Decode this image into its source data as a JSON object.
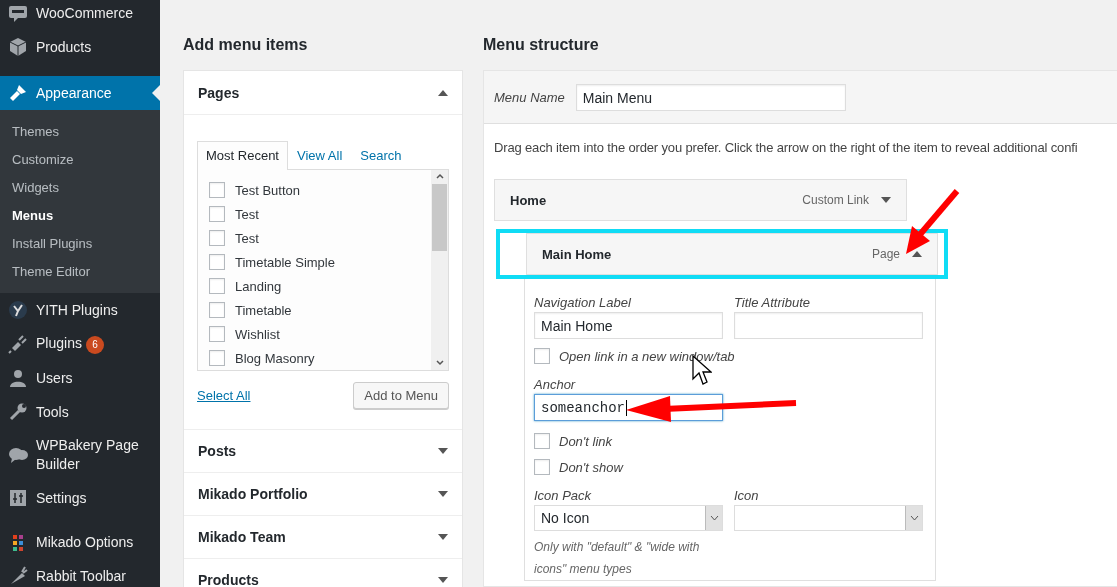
{
  "sidebar": {
    "items": [
      {
        "label": "WooCommerce",
        "selected": false
      },
      {
        "label": "Products",
        "selected": false
      },
      {
        "label": "Appearance",
        "selected": true,
        "children": [
          {
            "label": "Themes",
            "selected": false
          },
          {
            "label": "Customize",
            "selected": false
          },
          {
            "label": "Widgets",
            "selected": false
          },
          {
            "label": "Menus",
            "selected": true
          },
          {
            "label": "Install Plugins",
            "selected": false
          },
          {
            "label": "Theme Editor",
            "selected": false
          }
        ]
      },
      {
        "label": "YITH Plugins",
        "selected": false
      },
      {
        "label": "Plugins",
        "selected": false,
        "badge": "6"
      },
      {
        "label": "Users",
        "selected": false
      },
      {
        "label": "Tools",
        "selected": false
      },
      {
        "label": "WPBakery Page Builder",
        "selected": false
      },
      {
        "label": "Settings",
        "selected": false
      },
      {
        "label": "Mikado Options",
        "selected": false
      },
      {
        "label": "Rabbit Toolbar",
        "selected": false
      }
    ]
  },
  "add_menu_items": {
    "title": "Add menu items",
    "sections": [
      {
        "title": "Pages",
        "expanded": true,
        "tabs": [
          {
            "label": "Most Recent",
            "selected": true
          },
          {
            "label": "View All",
            "selected": false
          },
          {
            "label": "Search",
            "selected": false
          }
        ],
        "items": [
          {
            "label": "Test Button",
            "checked": false
          },
          {
            "label": "Test",
            "checked": false
          },
          {
            "label": "Test",
            "checked": false
          },
          {
            "label": "Timetable Simple",
            "checked": false
          },
          {
            "label": "Landing",
            "checked": false
          },
          {
            "label": "Timetable",
            "checked": false
          },
          {
            "label": "Wishlist",
            "checked": false
          },
          {
            "label": "Blog Masonry",
            "checked": false
          }
        ],
        "select_all": "Select All",
        "button": "Add to Menu"
      },
      {
        "title": "Posts",
        "expanded": false
      },
      {
        "title": "Mikado Portfolio",
        "expanded": false
      },
      {
        "title": "Mikado Team",
        "expanded": false
      },
      {
        "title": "Products",
        "expanded": false
      }
    ]
  },
  "menu_structure": {
    "title": "Menu structure",
    "menu_name_label": "Menu Name",
    "menu_name": "Main Menu",
    "instructions": "Drag each item into the order you prefer. Click the arrow on the right of the item to reveal additional confi",
    "items": [
      {
        "title": "Home",
        "type": "Custom Link",
        "expanded": false,
        "children": [
          {
            "title": "Main Home",
            "type": "Page",
            "expanded": true,
            "highlighted": true,
            "settings": {
              "text_fields": [
                {
                  "label": "Navigation Label",
                  "value": "Main Home"
                },
                {
                  "label": "Title Attribute"
                }
              ],
              "new_tab": {
                "label": "Open link in a new window/tab",
                "checked": false
              },
              "anchor": {
                "label": "Anchor",
                "value": "someanchor",
                "focused": true
              },
              "options": [
                {
                  "label": "Don't link",
                  "checked": false
                },
                {
                  "label": "Don't show",
                  "checked": false
                }
              ],
              "selects": [
                {
                  "label": "Icon Pack",
                  "value": "No Icon"
                },
                {
                  "label": "Icon"
                }
              ],
              "hint": "Only with \"default\" & \"wide with icons\" menu types"
            }
          }
        ]
      }
    ]
  }
}
